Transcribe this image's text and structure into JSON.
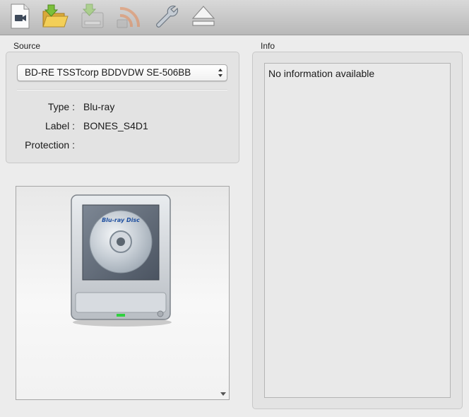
{
  "toolbar": {
    "buttons": [
      {
        "name": "open-video-file",
        "icon": "video-file-icon"
      },
      {
        "name": "open-folder",
        "icon": "folder-open-icon"
      },
      {
        "name": "backup",
        "icon": "disk-backup-icon"
      },
      {
        "name": "stream",
        "icon": "rss-stream-icon"
      },
      {
        "name": "settings",
        "icon": "wrench-icon"
      },
      {
        "name": "eject",
        "icon": "eject-icon"
      }
    ]
  },
  "source": {
    "title": "Source",
    "drive": "BD-RE TSSTcorp BDDVDW SE-506BB",
    "fields": [
      {
        "label": "Type :",
        "value": "Blu-ray"
      },
      {
        "label": "Label :",
        "value": "BONES_S4D1"
      },
      {
        "label": "Protection :",
        "value": ""
      }
    ],
    "disc_logo_text": "Blu-ray Disc"
  },
  "info": {
    "title": "Info",
    "text": "No information available"
  },
  "colors": {
    "toolbar_folder": "#f0c84a",
    "toolbar_green_arrow": "#7bbf3a",
    "rss_orange": "#e8834a",
    "drive_led": "#30d040"
  }
}
